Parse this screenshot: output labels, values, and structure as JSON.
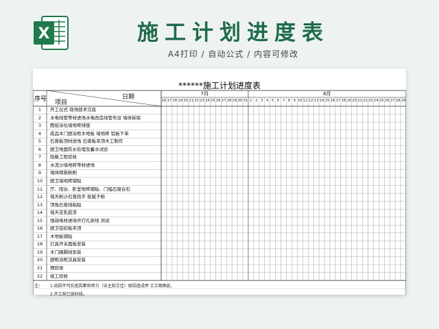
{
  "banner": {
    "title": "施工计划进度表",
    "subtitle": "A4打印 / 自动公式 / 内容可修改",
    "icon": "excel-icon",
    "accent": "#1f6b4a"
  },
  "sheet": {
    "title": "******施工计划进度表",
    "col_seq": "序号",
    "col_item": "项目",
    "col_date": "日期",
    "month1": "7月",
    "month2": "8月",
    "days_july": [
      "16",
      "17",
      "18",
      "19",
      "20",
      "21",
      "22",
      "23",
      "24",
      "25",
      "26",
      "27",
      "28",
      "29",
      "30",
      "31"
    ],
    "days_aug": [
      "1",
      "2",
      "3",
      "4",
      "5",
      "6",
      "7",
      "8",
      "9",
      "10",
      "11",
      "12",
      "13",
      "14",
      "15",
      "16",
      "17",
      "18",
      "19",
      "20",
      "21",
      "22",
      "23",
      "24",
      "25",
      "26",
      "27",
      "28",
      "29"
    ],
    "rows": [
      {
        "num": "1",
        "label": "开工仪式  现场技术交底"
      },
      {
        "num": "2",
        "label": "水电线管等材进场水电改造线管布设  墙体拆除"
      },
      {
        "num": "3",
        "label": "图纸深化墙地砖排版"
      },
      {
        "num": "4",
        "label": "成品木门厨浴柜木地板  墙地砖  铝板下单"
      },
      {
        "num": "5",
        "label": "石膏板顶材进场  石膏板吊顶木工制作"
      },
      {
        "num": "6",
        "label": "厨卫地面防水处理及蓄水试验"
      },
      {
        "num": "7",
        "label": "隐蔽工程验收"
      },
      {
        "num": "8",
        "label": "水泥沙墙地砖等材进场"
      },
      {
        "num": "9",
        "label": "墙体砌筑粉刷"
      },
      {
        "num": "10",
        "label": "厨卫墙地砖铺贴"
      },
      {
        "num": "11",
        "label": "厅、阳台、卧室地砖铺贴、门槛石窗台石"
      },
      {
        "num": "12",
        "label": "墙天粉沙石膏找平  批腻子粉"
      },
      {
        "num": "13",
        "label": "顶角石膏线粘贴"
      },
      {
        "num": "14",
        "label": "墙天花乳胶漆"
      },
      {
        "num": "15",
        "label": "强弱电材进场开灯孔穿线          测试"
      },
      {
        "num": "16",
        "label": "厨卫铝扣板吊顶"
      },
      {
        "num": "17",
        "label": "木地板铺贴"
      },
      {
        "num": "18",
        "label": "灯具开关面板安装"
      },
      {
        "num": "19",
        "label": "木门踢脚线安装"
      },
      {
        "num": "20",
        "label": "厨柜浴柜洁具安装"
      },
      {
        "num": "21",
        "label": "预验收"
      },
      {
        "num": "22",
        "label": "竣工验收"
      }
    ],
    "note_label": "注：",
    "notes": [
      "1.如因不可抗拒因素和甲方（业主和艾佳）原因造成停  工工期顺延。",
      "2.开工前已放好线。"
    ]
  }
}
